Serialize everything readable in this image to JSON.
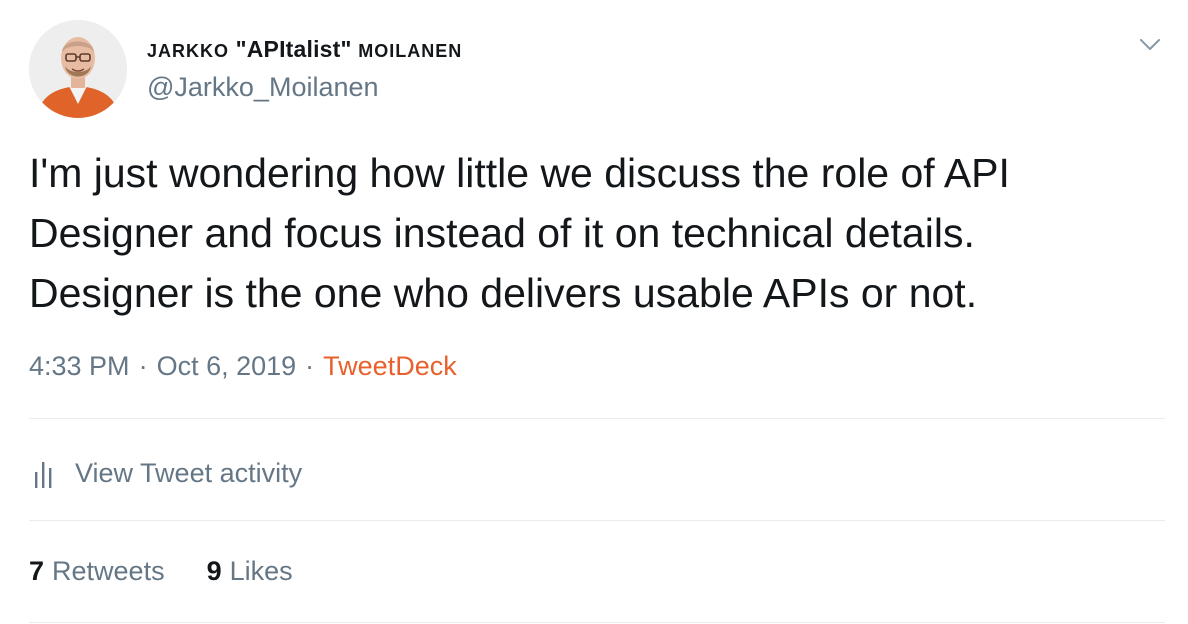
{
  "author": {
    "display_name_prefix": "Jarkko",
    "display_name_nick": "\"APItalist\"",
    "display_name_suffix": "Moilanen",
    "handle": "@Jarkko_Moilanen"
  },
  "tweet": {
    "text": "I'm just wondering how little we discuss the role of API\nDesigner and focus instead of it on technical details.\nDesigner is the one who delivers usable APIs or not.",
    "time": "4:33 PM",
    "date": "Oct 6, 2019",
    "separator": "·",
    "source": "TweetDeck"
  },
  "activity": {
    "label": "View Tweet activity",
    "icon": "bar-chart-icon"
  },
  "stats": {
    "retweets_count": "7",
    "retweets_label": "Retweets",
    "likes_count": "9",
    "likes_label": "Likes"
  },
  "colors": {
    "text": "#14171a",
    "secondary": "#657786",
    "source_link": "#e8612c",
    "divider": "#e6ecf0",
    "avatar_jacket": "#e0642a"
  },
  "icons": [
    "avatar",
    "chevron-down-icon",
    "bar-chart-icon"
  ]
}
